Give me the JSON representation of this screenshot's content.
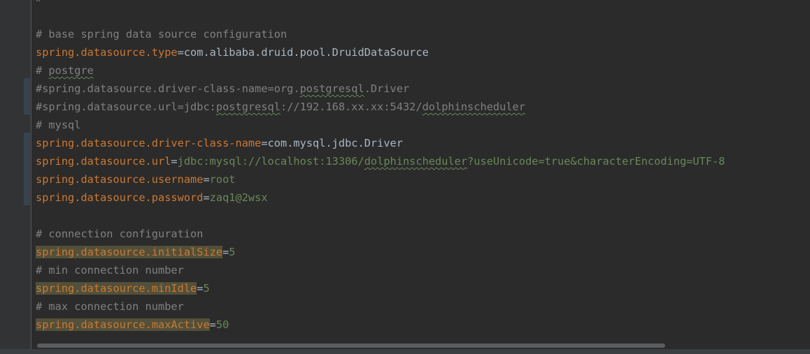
{
  "colors": {
    "background": "#2b2b2b",
    "gutter": "#313335",
    "comment": "#808080",
    "key": "#cc7832",
    "string_value": "#6a8759",
    "class_value": "#a9b7c6",
    "highlight": "#52503a"
  },
  "lines": {
    "l00": {
      "c": "#"
    },
    "l01": {
      "c": ""
    },
    "l02": {
      "c": "# base spring data source configuration"
    },
    "l03": {
      "k": "spring.datasource.type",
      "eq": "=",
      "v": "com.alibaba.druid.pool.DruidDataSource"
    },
    "l04": {
      "c1": "# ",
      "c2": "postgre"
    },
    "l05": {
      "c1": "#spring.datasource.driver-class-name=org.",
      "c2": "postgresql",
      "c3": ".Driver"
    },
    "l06": {
      "c1": "#spring.datasource.url=jdbc:",
      "c2": "postgresql",
      "c3": "://192.168.xx.xx:5432/",
      "c4": "dolphinscheduler"
    },
    "l07": {
      "c": "# mysql"
    },
    "l08": {
      "k": "spring.datasource.driver-class-name",
      "eq": "=",
      "v": "com.mysql.jdbc.Driver"
    },
    "l09": {
      "k": "spring.datasource.url",
      "eq": "=",
      "v1": "jdbc:mysql://localhost:13306/",
      "v2": "dolphinscheduler",
      "v3": "?useUnicode=true&characterEncoding=UTF-8"
    },
    "l10": {
      "k": "spring.datasource.username",
      "eq": "=",
      "v": "root"
    },
    "l11": {
      "k": "spring.datasource.password",
      "eq": "=",
      "v": "zaq1@2wsx"
    },
    "l12": {
      "c": ""
    },
    "l13": {
      "c": "# connection configuration"
    },
    "l14": {
      "k": "spring.datasource.initialSize",
      "eq": "=",
      "v": "5"
    },
    "l15": {
      "c": "# min connection number"
    },
    "l16": {
      "k": "spring.datasource.minIdle",
      "eq": "=",
      "v": "5"
    },
    "l17": {
      "c": "# max connection number"
    },
    "l18": {
      "k": "spring.datasource.maxActive",
      "eq": "=",
      "v": "50"
    }
  }
}
